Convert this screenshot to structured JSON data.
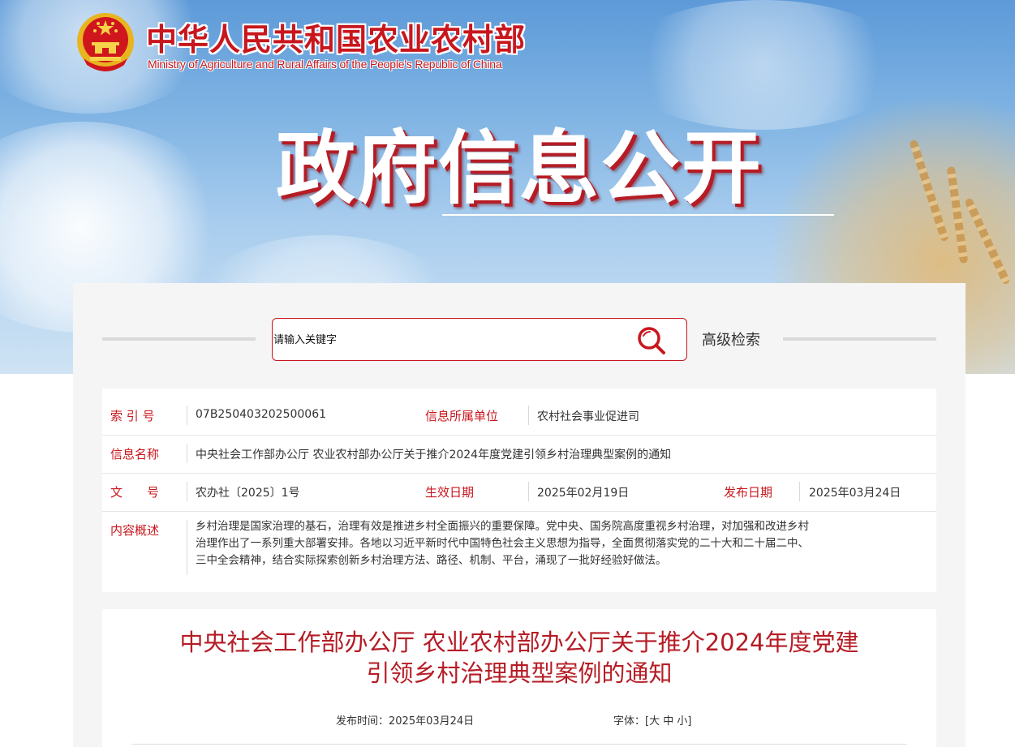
{
  "header": {
    "brand_cn": "中华人民共和国农业农村部",
    "brand_en": "Ministry of Agriculture and Rural Affairs of the People's Republic of China",
    "hero_title": "政府信息公开",
    "emblem_icon": "national-emblem-icon"
  },
  "search": {
    "placeholder": "请输入关键字",
    "search_icon": "search-icon",
    "advanced_label": "高级检索"
  },
  "info": {
    "index_label": "索 引 号",
    "index_value": "07B250403202500061",
    "unit_label": "信息所属单位",
    "unit_value": "农村社会事业促进司",
    "name_label": "信息名称",
    "name_value": "中央社会工作部办公厅 农业农村部办公厅关于推介2024年度党建引领乡村治理典型案例的通知",
    "docno_label": "文　　号",
    "docno_value": "农办社〔2025〕1号",
    "effective_label": "生效日期",
    "effective_value": "2025年02月19日",
    "publish_label": "发布日期",
    "publish_value": "2025年03月24日",
    "summary_label": "内容概述",
    "summary_lines": [
      "乡村治理是国家治理的基石，治理有效是推进乡村全面振兴的重要保障。党中央、国务院高度重视乡村治理，对加强和改进乡村",
      "治理作出了一系列重大部署安排。各地以习近平新时代中国特色社会主义思想为指导，全面贯彻落实党的二十大和二十届二中、",
      "三中全会精神，结合实际探索创新乡村治理方法、路径、机制、平台，涌现了一批好经验好做法。"
    ]
  },
  "article": {
    "title_lines": [
      "中央社会工作部办公厅 农业农村部办公厅关于推介2024年度党建",
      "引领乡村治理典型案例的通知"
    ],
    "publish_time_label": "发布时间：",
    "publish_time_value": "2025年03月24日",
    "font_label": "字体：",
    "font_open": "[",
    "font_large": "大",
    "font_medium": "中",
    "font_small": "小",
    "font_close": "]"
  },
  "colors": {
    "brand_red": "#c8161d",
    "title_red": "#b51c25",
    "panel_bg": "#f5f5f5"
  }
}
